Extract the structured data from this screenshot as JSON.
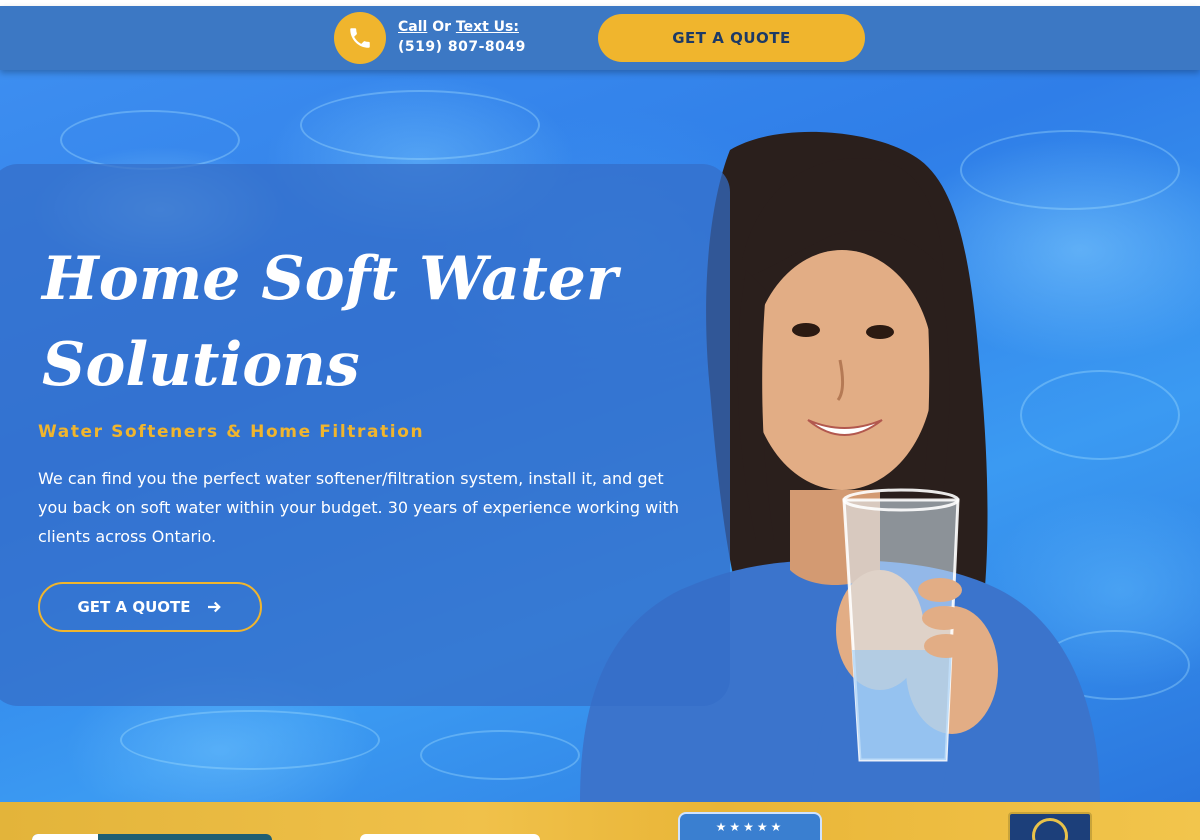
{
  "header": {
    "call_word": "Call",
    "or_word": " Or ",
    "text_us": "Text Us:",
    "phone": "(519) 807-8049",
    "quote_button": "GET A QUOTE"
  },
  "hero": {
    "title_line1": "Home Soft Water",
    "title_line2": "Solutions",
    "subtitle": "Water Softeners & Home Filtration",
    "description": "We can find you the perfect water softener/filtration system, install it, and get you back on soft water within your budget. 30 years of experience working with clients across Ontario.",
    "cta": "GET A QUOTE"
  },
  "colors": {
    "header_bg": "#3c78c4",
    "accent_yellow": "#f0b52d",
    "hero_blue": "#2f7ee8",
    "text_white": "#ffffff"
  },
  "icons": {
    "phone": "phone-icon",
    "arrow": "arrow-right-icon"
  },
  "bottom": {
    "stars": "★★★★★"
  }
}
